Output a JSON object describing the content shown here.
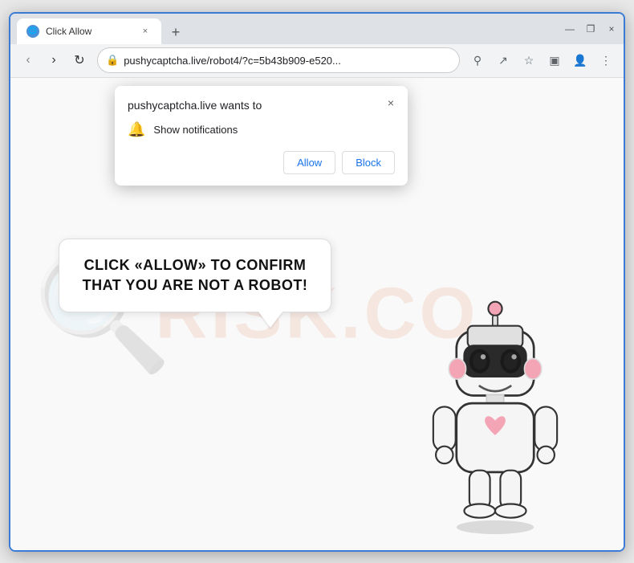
{
  "window": {
    "title": "Click Allow",
    "url": "pushycaptcha.live/robot4/?c=5b43b909-e520...",
    "url_full": "pushycaptcha.live/robot4/?c=5b43b909-e520..."
  },
  "titlebar": {
    "tab_title": "Click Allow",
    "close_btn": "×",
    "new_tab_btn": "+",
    "minimize_icon": "—",
    "maximize_icon": "❐",
    "close_icon": "×"
  },
  "navbar": {
    "back_icon": "‹",
    "forward_icon": "›",
    "reload_icon": "↻",
    "search_icon": "⚲",
    "share_icon": "↗",
    "bookmark_icon": "☆",
    "extensions_icon": "▣",
    "profile_icon": "👤",
    "menu_icon": "⋮"
  },
  "popup": {
    "title": "pushycaptcha.live wants to",
    "close_label": "×",
    "notification_label": "Show notifications",
    "allow_label": "Allow",
    "block_label": "Block"
  },
  "bubble": {
    "text": "CLICK «ALLOW» TO CONFIRM THAT YOU ARE NOT A ROBOT!"
  },
  "watermark": {
    "text": "RISK.CO"
  }
}
